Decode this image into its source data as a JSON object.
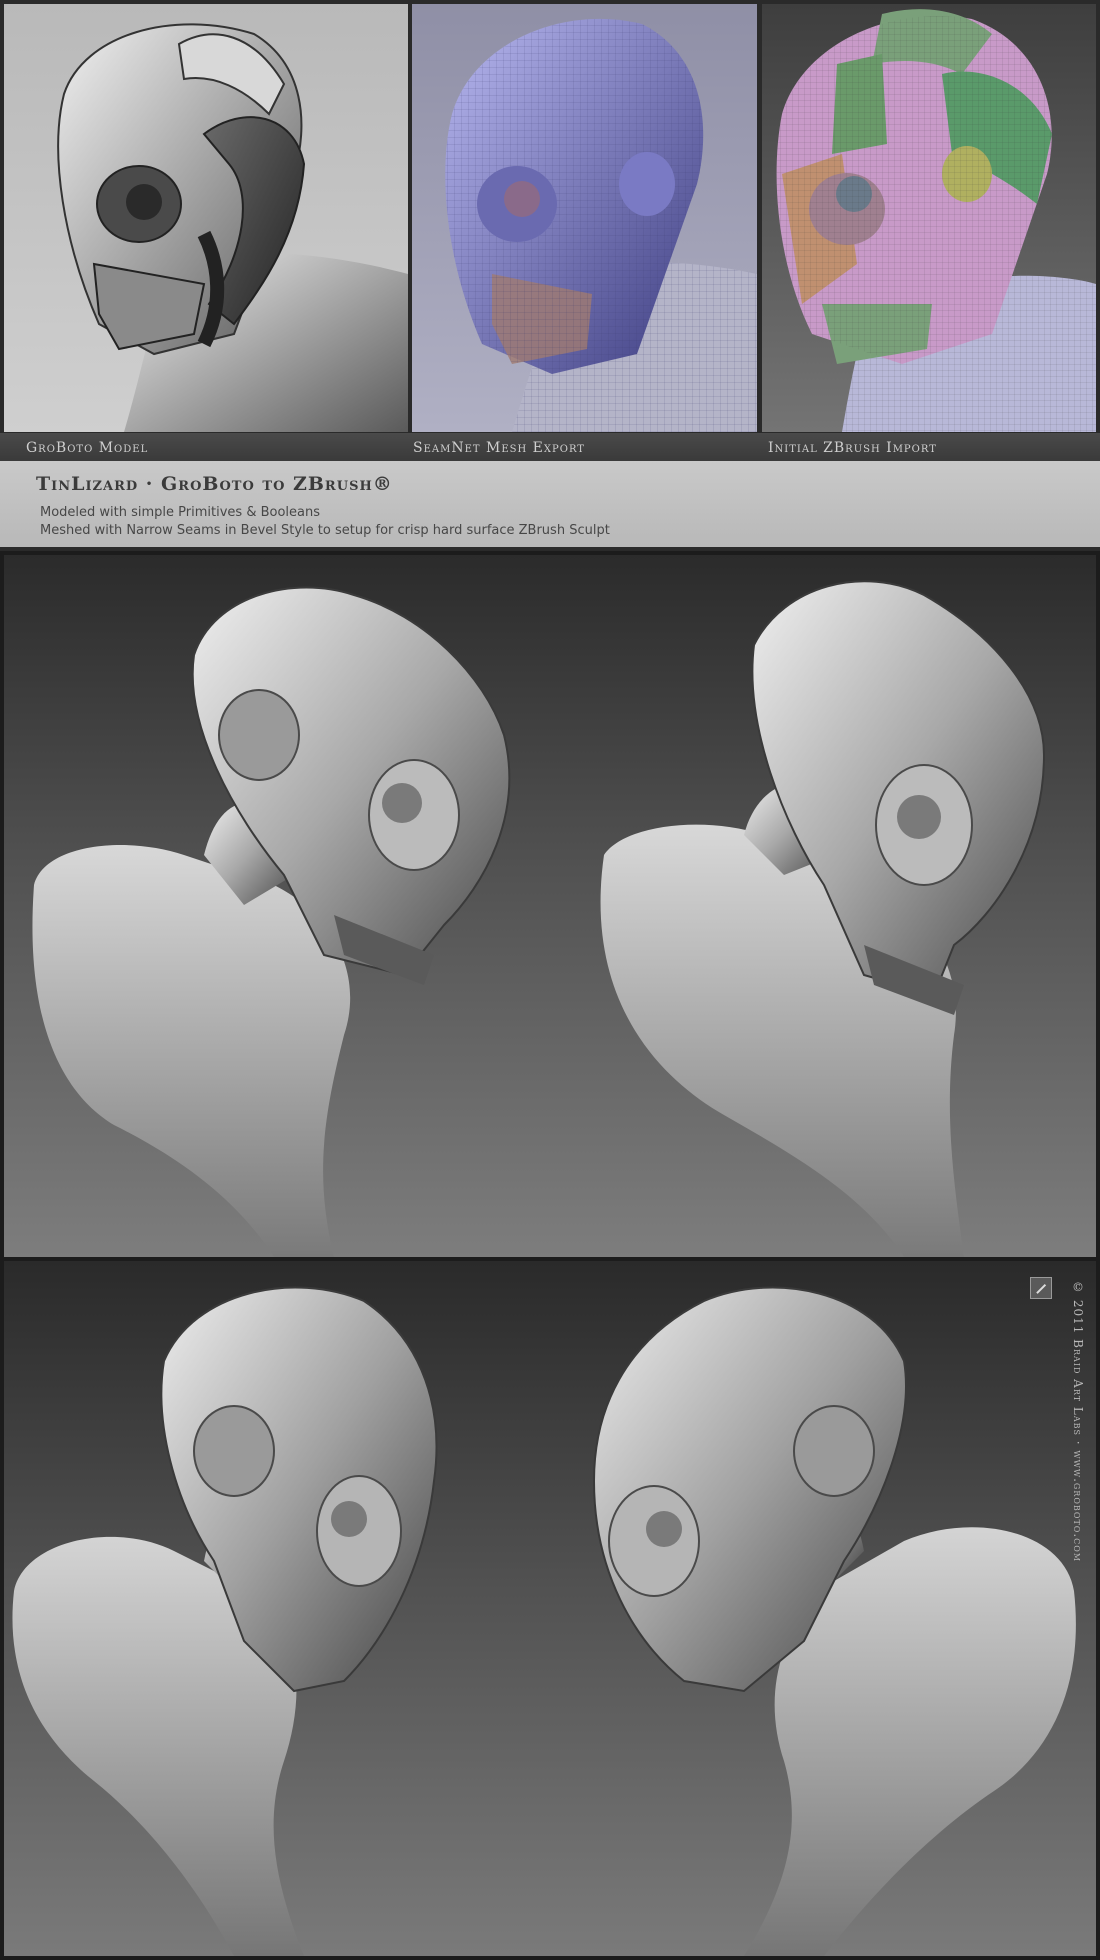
{
  "panels": [
    {
      "caption": "GroBoto Model"
    },
    {
      "caption": "SeamNet Mesh Export"
    },
    {
      "caption": "Initial ZBrush Import"
    }
  ],
  "title": "TinLizard · GroBoto to ZBrush®",
  "subtitle_lines": [
    "Modeled with simple Primitives & Booleans",
    "Meshed with Narrow Seams in Bevel Style to setup for crisp hard surface ZBrush Sculpt"
  ],
  "copyright": "© 2011 Braid Art Labs · www.groboto.com",
  "colors": {
    "frame": "#2a2a2a",
    "title_band": "#c2c2c2",
    "mesh_blue": "#7a7ac0",
    "polygroup_pink": "#c89ac8",
    "polygroup_green": "#6a9a6a",
    "polygroup_tan": "#c09070"
  },
  "icons": [
    "braid-art-labs-logo-icon"
  ]
}
